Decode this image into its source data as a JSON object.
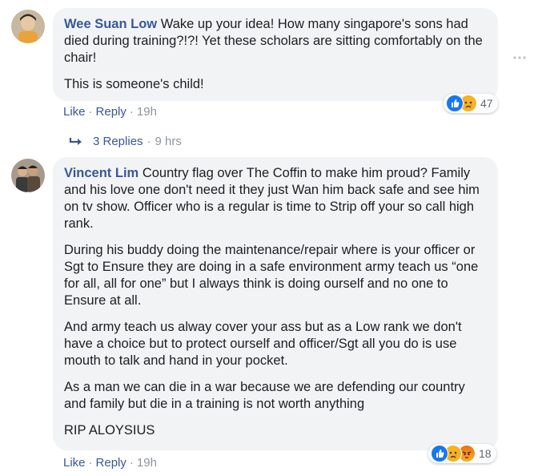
{
  "comments": [
    {
      "author": "Wee Suan Low",
      "paragraphs": [
        "Wake up your idea! How many singapore's sons had died during training?!?! Yet these scholars are sitting comfortably on the chair!",
        "This is someone's child!"
      ],
      "actions": {
        "like": "Like",
        "reply": "Reply",
        "time": "19h"
      },
      "reactions": {
        "icons": [
          "like-icon",
          "sad-icon"
        ],
        "count": "47"
      },
      "replies": {
        "label": "3 Replies",
        "time": "9 hrs"
      }
    },
    {
      "author": "Vincent Lim",
      "paragraphs": [
        "Country flag over The Coffin to make him proud? Family and his love one don't need it they just Wan him back safe and see him on tv show. Officer who is a regular is time to Strip off your so call high rank.",
        "During his buddy doing the maintenance/repair where is your officer or Sgt to Ensure they are doing in a safe environment army teach us “one for all, all for one” but I always think is doing ourself and no one to Ensure at all.",
        "And army teach us alway cover your ass but as a Low rank we don't have a choice but to protect ourself and officer/Sgt all you do is use mouth to talk and hand in your pocket.",
        "As a man we can die in a war because we are defending our country and family but die in a training is not worth anything",
        "RIP ALOYSIUS"
      ],
      "actions": {
        "like": "Like",
        "reply": "Reply",
        "time": "19h"
      },
      "reactions": {
        "icons": [
          "like-icon",
          "sad-icon",
          "angry-icon"
        ],
        "count": "18"
      }
    }
  ],
  "colors": {
    "link": "#385898",
    "meta": "#90949c",
    "bubble": "#f2f3f5"
  }
}
